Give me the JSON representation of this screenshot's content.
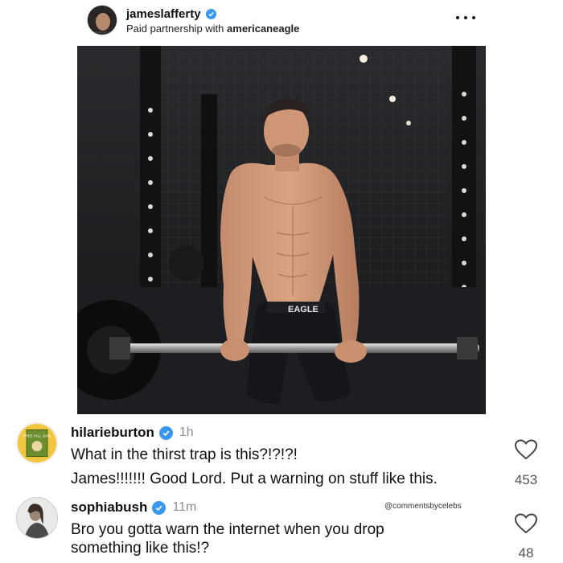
{
  "post": {
    "username": "jameslafferty",
    "partnership_prefix": "Paid partnership with",
    "partner": "americaneagle",
    "more_icon": "more-horizontal-icon",
    "photo_waistband_text": "EAGLE"
  },
  "comments": [
    {
      "username": "hilarieburton",
      "time": "1h",
      "lines": [
        "What in the thirst trap is this?!?!?!",
        "James!!!!!!! Good Lord. Put a warning on stuff like this."
      ],
      "likes": "453",
      "avatar_text": "TREE HILL GIRL"
    },
    {
      "username": "sophiabush",
      "time": "11m",
      "lines": [
        "Bro you gotta warn the internet when you drop",
        "something like this!?"
      ],
      "likes": "48"
    }
  ],
  "watermark": "@commentsbycelebs",
  "colors": {
    "verified_blue": "#3897f0",
    "muted_gray": "#8e8e8e"
  }
}
